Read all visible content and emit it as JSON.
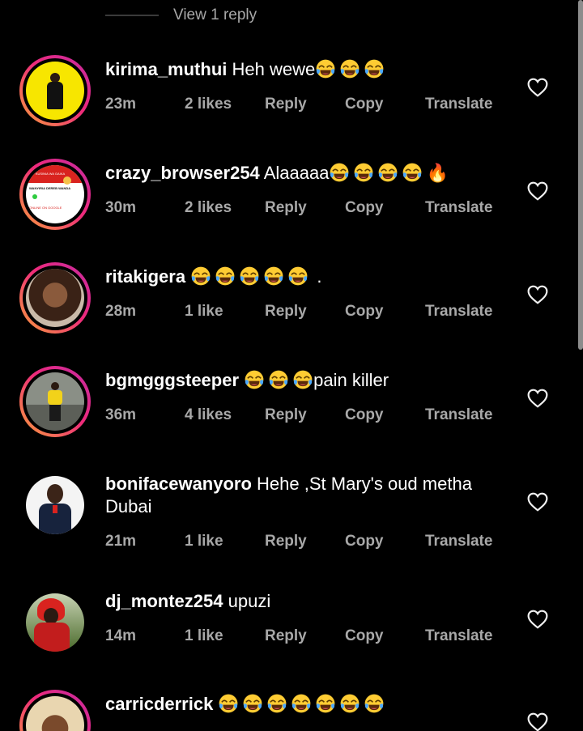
{
  "thread": {
    "view_reply": "View 1 reply"
  },
  "labels": {
    "reply": "Reply",
    "copy": "Copy",
    "translate": "Translate"
  },
  "comments": [
    {
      "username": "kirima_muthui",
      "text": "Heh wewe",
      "emoji_after": 3,
      "time": "23m",
      "likes": "2 likes"
    },
    {
      "username": "crazy_browser254",
      "text": "Alaaaaa",
      "emoji_after": 4,
      "extra": "🔥",
      "time": "30m",
      "likes": "2 likes",
      "avatar_text": {
        "line1": "KUSINIA WA GAIKA",
        "line2": "WANYIRIA DEREB WANDA",
        "line3": "ONLINE ON GOOGLE"
      }
    },
    {
      "username": "ritakigera",
      "text": "",
      "emoji_before": 5,
      "suffix": ".",
      "time": "28m",
      "likes": "1 like"
    },
    {
      "username": "bgmgggsteeper",
      "text": "pain killer",
      "emoji_before": 3,
      "time": "36m",
      "likes": "4 likes"
    },
    {
      "username": "bonifacewanyoro",
      "text": "Hehe ,St Mary's oud metha",
      "text_line2": "Dubai",
      "time": "21m",
      "likes": "1 like"
    },
    {
      "username": "dj_montez254",
      "text": "upuzi",
      "time": "14m",
      "likes": "1 like"
    },
    {
      "username": "carricderrick",
      "text": "",
      "emoji_before": 7
    }
  ],
  "colors": {
    "bg": "#000000",
    "meta": "#a8a8a8",
    "ring_start": "#f9a03b",
    "ring_end": "#c32aa3"
  }
}
